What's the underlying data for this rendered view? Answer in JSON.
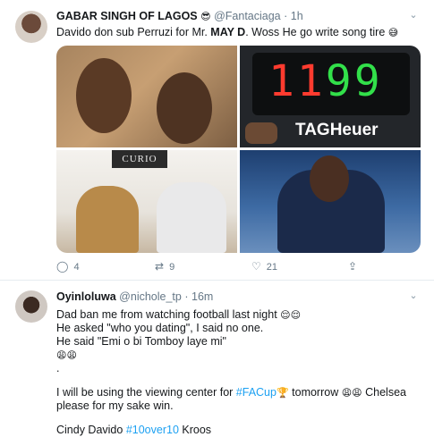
{
  "tweet1": {
    "author_name": "GABAR SINGH OF LAGOS",
    "author_emoji": "😎",
    "handle": "@Fantaciaga",
    "separator": "·",
    "time": "1h",
    "text_before": "Davido don sub Perruzi for Mr. ",
    "text_bold": "MAY D",
    "text_after": ". Woss He go write song tire ",
    "text_emoji": "😅",
    "images": {
      "scoreboard_red": "11",
      "scoreboard_green": "99",
      "brand": "TAGHeuer",
      "sign": "CURIO"
    },
    "actions": {
      "reply_count": "4",
      "retweet_count": "9",
      "like_count": "21"
    }
  },
  "tweet2": {
    "author_name": "Oyinloluwa",
    "handle": "@nichole_tp",
    "separator": "·",
    "time": "16m",
    "lines": {
      "l1_text": "Dad ban me from watching football last night ",
      "l1_emoji": "😌😌",
      "l2": "He asked \"who you dating\", I said no one.",
      "l3": "He said \"Emi o bi Tomboy laye mi\"",
      "l4_emoji": "😩😩",
      "l5": ".",
      "l6_before": "I will be using the viewing center for ",
      "l6_tag": "#FACup",
      "l6_cup": "🏆",
      "l6_after": " tomorrow ",
      "l6_emoji": "😩😩",
      "l6_end": " Chelsea",
      "l7": "please for my sake win.",
      "l8_before": "Cindy Davido ",
      "l8_tag": "#10over10",
      "l8_after": " Kroos"
    }
  },
  "icons": {
    "caret": "⌄",
    "reply": "◯",
    "retweet": "⇄",
    "like": "♡",
    "share": "⇪"
  },
  "colors": {
    "link": "#1da1f2",
    "muted": "#657786"
  }
}
